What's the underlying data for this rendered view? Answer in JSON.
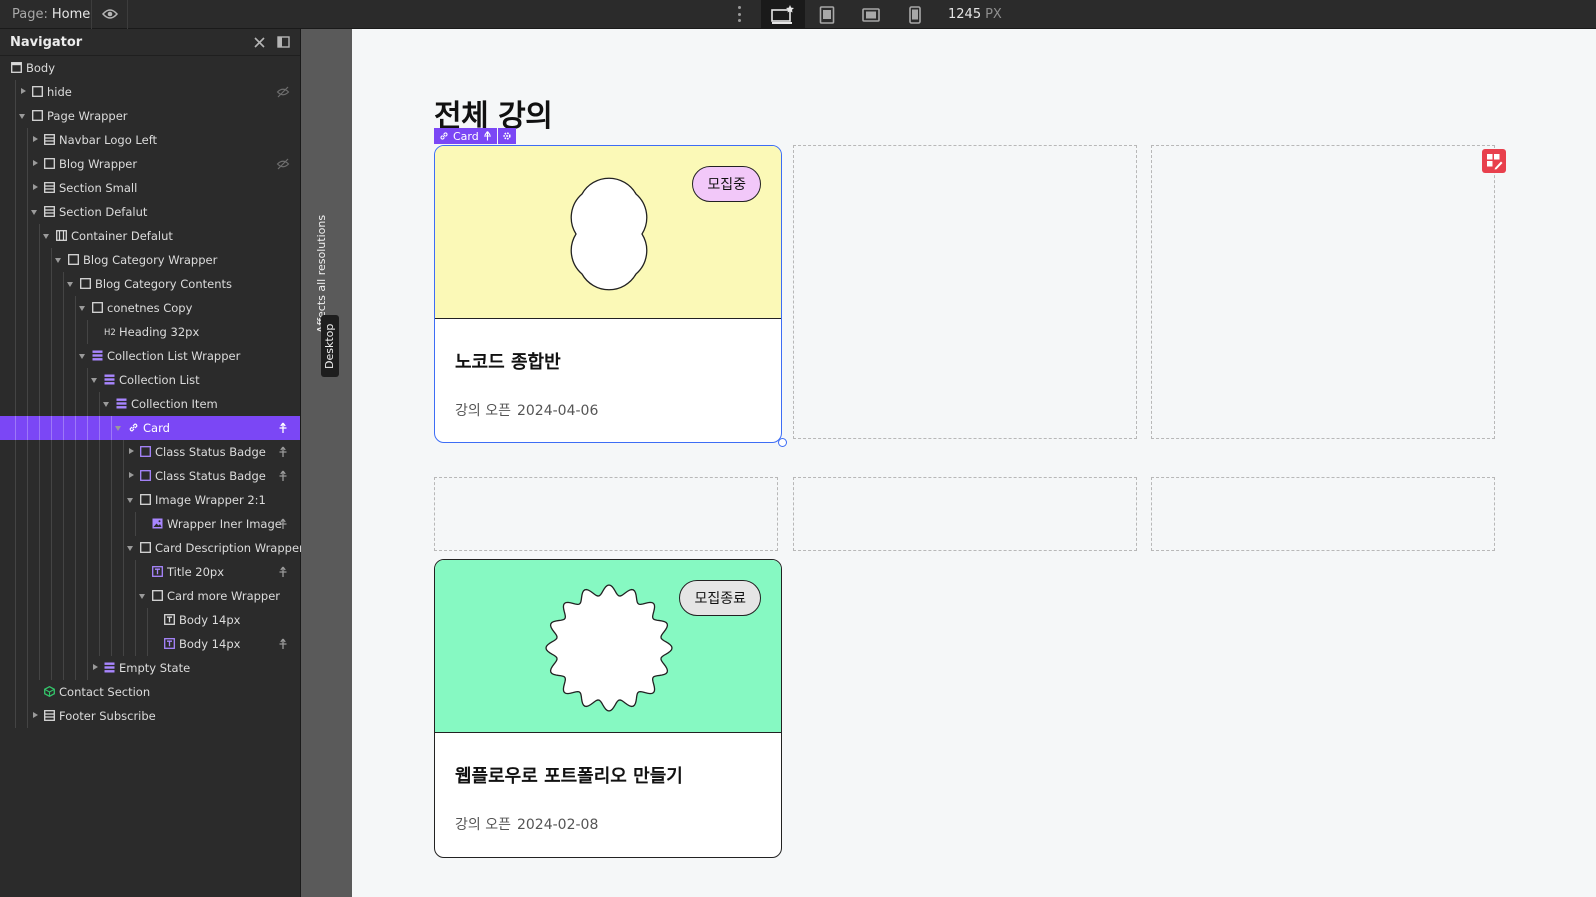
{
  "topbar": {
    "page_prefix": "Page:",
    "page_name": "Home",
    "width_value": "1245",
    "width_unit": "PX",
    "icons": [
      "eye-icon",
      "desktop-star-icon",
      "tablet-icon",
      "landscape-icon",
      "phone-icon"
    ]
  },
  "navigator": {
    "title": "Navigator",
    "items": [
      {
        "label": "Body",
        "depth": 0,
        "caret": "none",
        "icon": "body"
      },
      {
        "label": "hide",
        "depth": 1,
        "caret": "right",
        "icon": "box",
        "trail": "hidden-icon"
      },
      {
        "label": "Page Wrapper",
        "depth": 1,
        "caret": "down",
        "icon": "box"
      },
      {
        "label": "Navbar Logo Left",
        "depth": 2,
        "caret": "right",
        "icon": "section"
      },
      {
        "label": "Blog Wrapper",
        "depth": 2,
        "caret": "right",
        "icon": "box",
        "trail": "hidden-icon"
      },
      {
        "label": "Section Small",
        "depth": 2,
        "caret": "right",
        "icon": "section"
      },
      {
        "label": "Section Defalut",
        "depth": 2,
        "caret": "down",
        "icon": "section"
      },
      {
        "label": "Container Defalut",
        "depth": 3,
        "caret": "down",
        "icon": "container"
      },
      {
        "label": "Blog Category Wrapper",
        "depth": 4,
        "caret": "down",
        "icon": "box"
      },
      {
        "label": "Blog Category Contents",
        "depth": 5,
        "caret": "down",
        "icon": "box"
      },
      {
        "label": "conetnes Copy",
        "depth": 6,
        "caret": "down",
        "icon": "box"
      },
      {
        "label": "Heading 32px",
        "depth": 7,
        "caret": "none",
        "icon": "h2"
      },
      {
        "label": "Collection List Wrapper",
        "depth": 6,
        "caret": "down",
        "icon": "cms"
      },
      {
        "label": "Collection List",
        "depth": 7,
        "caret": "down",
        "icon": "cms"
      },
      {
        "label": "Collection Item",
        "depth": 8,
        "caret": "down",
        "icon": "cms"
      },
      {
        "label": "Card",
        "depth": 9,
        "caret": "down",
        "icon": "link",
        "trail": "pin-icon",
        "selected": true
      },
      {
        "label": "Class Status Badge",
        "depth": 10,
        "caret": "right",
        "icon": "pbox",
        "trail": "pin-icon"
      },
      {
        "label": "Class Status Badge",
        "depth": 10,
        "caret": "right",
        "icon": "pbox",
        "trail": "pin-icon"
      },
      {
        "label": "Image Wrapper 2:1",
        "depth": 10,
        "caret": "down",
        "icon": "box"
      },
      {
        "label": "Wrapper Iner Image",
        "depth": 11,
        "caret": "none",
        "icon": "image",
        "trail": "pin-icon"
      },
      {
        "label": "Card Description Wrapper",
        "depth": 10,
        "caret": "down",
        "icon": "box"
      },
      {
        "label": "Title 20px",
        "depth": 11,
        "caret": "none",
        "icon": "ptext",
        "trail": "pin-icon"
      },
      {
        "label": "Card more Wrapper",
        "depth": 11,
        "caret": "down",
        "icon": "box"
      },
      {
        "label": "Body 14px",
        "depth": 12,
        "caret": "none",
        "icon": "text"
      },
      {
        "label": "Body 14px",
        "depth": 12,
        "caret": "none",
        "icon": "ptext",
        "trail": "pin-icon"
      },
      {
        "label": "Empty State",
        "depth": 7,
        "caret": "right",
        "icon": "cms"
      },
      {
        "label": "Contact Section",
        "depth": 2,
        "caret": "none",
        "icon": "component"
      },
      {
        "label": "Footer Subscribe",
        "depth": 2,
        "caret": "right",
        "icon": "section"
      }
    ]
  },
  "side_strip": {
    "affects_label": "Affects all resolutions",
    "breakpoint_label": "Desktop"
  },
  "canvas": {
    "heading": "전체 강의",
    "selected_tag": "Card",
    "cards": [
      {
        "badge": "모집중",
        "title": "노코드 종합반",
        "date_label": "강의 오픈",
        "date": "2024-04-06"
      },
      {
        "badge": "모집종료",
        "title": "웹플로우로 포트폴리오 만들기",
        "date_label": "강의 오픈",
        "date": "2024-02-08"
      }
    ]
  },
  "colors": {
    "accent": "#7b47f5",
    "selection_outline": "#3d6df5",
    "card1_image_bg": "#fbf9b7",
    "card1_badge_bg": "#f2c8f9",
    "card2_image_bg": "#86f9c2",
    "card2_badge_bg": "#e5e5e5",
    "empty_state_icon": "#e8404d"
  }
}
